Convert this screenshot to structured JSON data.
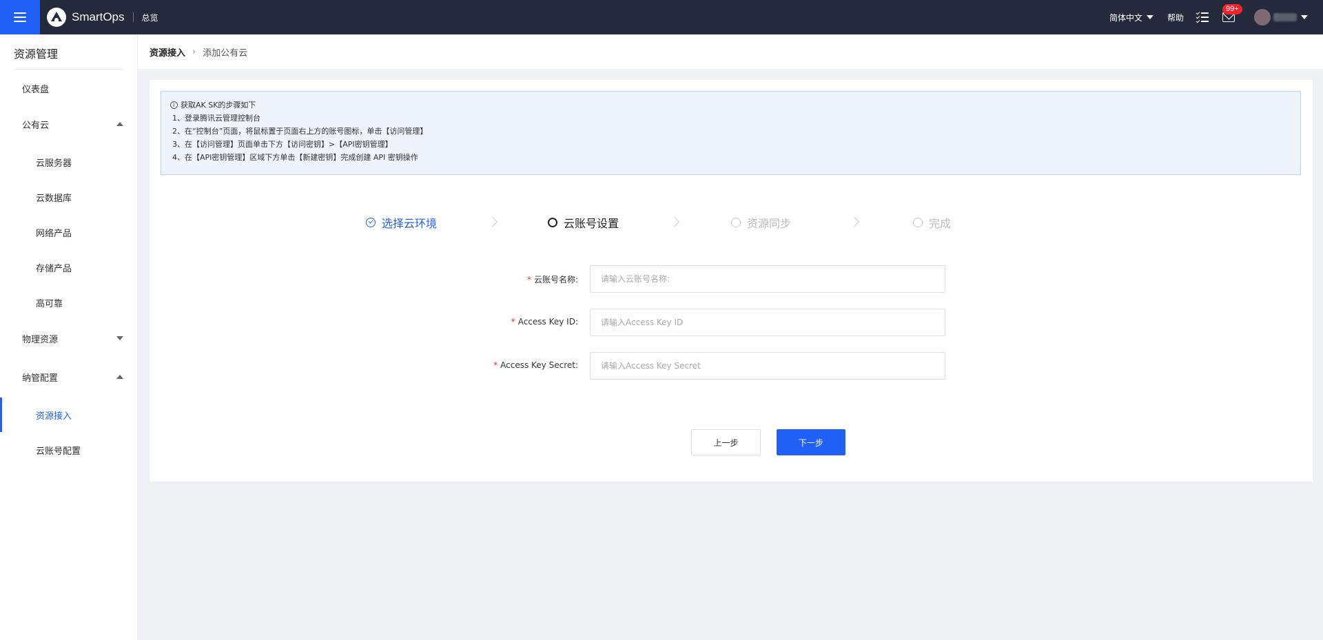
{
  "topbar": {
    "brand": "SmartOps",
    "overview": "总览",
    "language": "简体中文",
    "help": "帮助",
    "mail_badge": "99+",
    "colors": {
      "bar": "#232a3b",
      "accent": "#2160f6",
      "badge": "#f5222d"
    }
  },
  "sidebar": {
    "title": "资源管理",
    "items": [
      {
        "label": "仪表盘"
      },
      {
        "label": "公有云"
      },
      {
        "label": "云服务器"
      },
      {
        "label": "云数据库"
      },
      {
        "label": "网络产品"
      },
      {
        "label": "存储产品"
      },
      {
        "label": "高可靠"
      },
      {
        "label": "物理资源"
      },
      {
        "label": "纳管配置"
      },
      {
        "label": "资源接入"
      },
      {
        "label": "云账号配置"
      }
    ]
  },
  "breadcrumb": {
    "first": "资源接入",
    "current": "添加公有云"
  },
  "notice": {
    "title": "获取AK SK的步骤如下",
    "lines": [
      "1、登录腾讯云管理控制台",
      "2、在“控制台”页面，将鼠标置于页面右上方的账号图标，单击【访问管理】",
      "3、在【访问管理】页面单击下方【访问密钥】>【API密钥管理】",
      "4、在【API密钥管理】区域下方单击【新建密钥】完成创建 API 密钥操作"
    ]
  },
  "steps": [
    {
      "label": "选择云环境",
      "state": "done"
    },
    {
      "label": "云账号设置",
      "state": "current"
    },
    {
      "label": "资源同步",
      "state": "todo"
    },
    {
      "label": "完成",
      "state": "todo"
    }
  ],
  "form": {
    "account_name": {
      "label": "云账号名称:",
      "placeholder": "请输入云账号名称:",
      "value": ""
    },
    "access_key_id": {
      "label": "Access Key ID:",
      "placeholder": "请输入Access Key ID",
      "value": ""
    },
    "access_key_secret": {
      "label": "Access Key Secret:",
      "placeholder": "请输入Access Key Secret",
      "value": ""
    }
  },
  "actions": {
    "prev": "上一步",
    "next": "下一步"
  }
}
